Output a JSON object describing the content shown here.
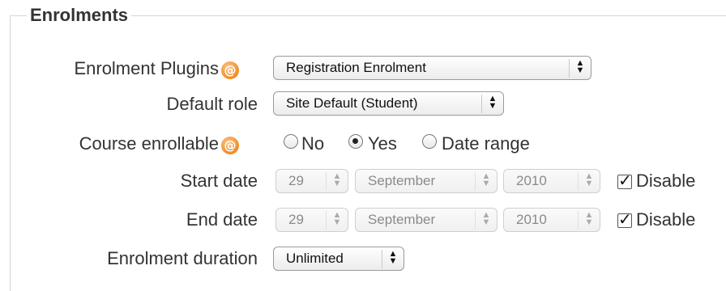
{
  "section": {
    "title": "Enrolments"
  },
  "fields": {
    "enrolment_plugins": {
      "label": "Enrolment Plugins",
      "help_icon": "help-icon",
      "value": "Registration Enrolment"
    },
    "default_role": {
      "label": "Default role",
      "value": "Site Default (Student)"
    },
    "course_enrollable": {
      "label": "Course enrollable",
      "help_icon": "help-icon",
      "options": [
        "No",
        "Yes",
        "Date range"
      ],
      "selected": "Yes"
    },
    "start_date": {
      "label": "Start date",
      "day": "29",
      "month": "September",
      "year": "2010",
      "disable_label": "Disable",
      "disabled": true
    },
    "end_date": {
      "label": "End date",
      "day": "29",
      "month": "September",
      "year": "2010",
      "disable_label": "Disable",
      "disabled": true
    },
    "enrolment_duration": {
      "label": "Enrolment duration",
      "value": "Unlimited"
    }
  },
  "colors": {
    "help_icon": "#f08b25",
    "disabled_text": "#8a8a8a"
  },
  "arrows_glyph": "▴\n▾"
}
